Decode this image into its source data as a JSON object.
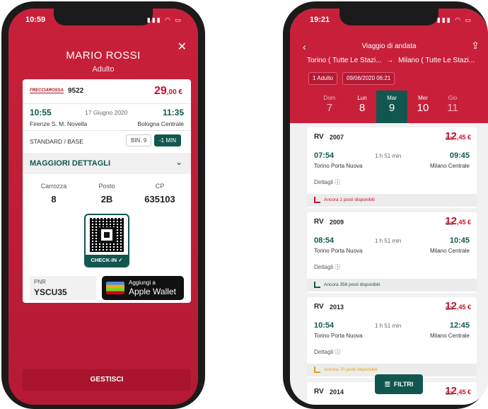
{
  "left": {
    "status_time": "10:59",
    "passenger_name": "MARIO ROSSI",
    "passenger_type": "Adulto",
    "ticket": {
      "brand": "FRECCIAROSSA",
      "train_number": "9522",
      "price_int": "29",
      "price_dec": ",00 €",
      "dep_time": "10:55",
      "date": "17 Giugno 2020",
      "arr_time": "11:35",
      "dep_station": "Firenze S. M. Novella",
      "arr_station": "Bologna Centrale",
      "class": "STANDARD / BASE",
      "platform": "BIN. 9",
      "delay": "-1 MIN",
      "details_title": "MAGGIORI DETTAGLI",
      "coach_label": "Carrozza",
      "coach_value": "8",
      "seat_label": "Posto",
      "seat_value": "2B",
      "cp_label": "CP",
      "cp_value": "635103",
      "checkin_label": "CHECK-IN ✓",
      "pnr_label": "PNR",
      "pnr_value": "YSCU35",
      "wallet_top": "Aggiungi a",
      "wallet_bottom": "Apple Wallet"
    },
    "manage_button": "GESTISCI"
  },
  "right": {
    "status_time": "19:21",
    "title": "Viaggio di andata",
    "route_from": "Torino ( Tutte Le Stazi...",
    "route_arrow": "→",
    "route_to": "Milano ( Tutte Le Stazi...",
    "passengers_chip": "1 Adulto",
    "datetime_chip": "09/06/2020 06:21",
    "days": [
      {
        "name": "Dom",
        "num": "7"
      },
      {
        "name": "Lun",
        "num": "8"
      },
      {
        "name": "Mar",
        "num": "9"
      },
      {
        "name": "Mer",
        "num": "10"
      },
      {
        "name": "Gio",
        "num": "11"
      }
    ],
    "results": [
      {
        "logo": "RV",
        "number": "2007",
        "from_label": "da",
        "price_int": "12",
        "price_dec": ",45 €",
        "dep": "07:54",
        "duration": "1 h 51 min",
        "arr": "09:45",
        "dep_station": "Torino Porta Nuova",
        "arr_station": "Milano Centrale",
        "details": "Dettagli ⓘ",
        "availability": "Ancora 1 posti disponibili",
        "avail_color": "#c8102e"
      },
      {
        "logo": "RV",
        "number": "2009",
        "from_label": "da",
        "price_int": "12",
        "price_dec": ",45 €",
        "dep": "08:54",
        "duration": "1 h 51 min",
        "arr": "10:45",
        "dep_station": "Torino Porta Nuova",
        "arr_station": "Milano Centrale",
        "details": "Dettagli ⓘ",
        "availability": "Ancora 358 posti disponibili",
        "avail_color": "#11574f"
      },
      {
        "logo": "RV",
        "number": "2013",
        "from_label": "da",
        "price_int": "12",
        "price_dec": ",45 €",
        "dep": "10:54",
        "duration": "1 h 51 min",
        "arr": "12:45",
        "dep_station": "Torino Porta Nuova",
        "arr_station": "Milano Centrale",
        "details": "Dettagli ⓘ",
        "availability": "Ancora 70 posti disponibili",
        "avail_color": "#e0a21b"
      },
      {
        "logo": "RV",
        "number": "2014",
        "from_label": "da",
        "price_int": "12",
        "price_dec": ",45 €"
      }
    ],
    "filter_button": "FILTRI"
  }
}
